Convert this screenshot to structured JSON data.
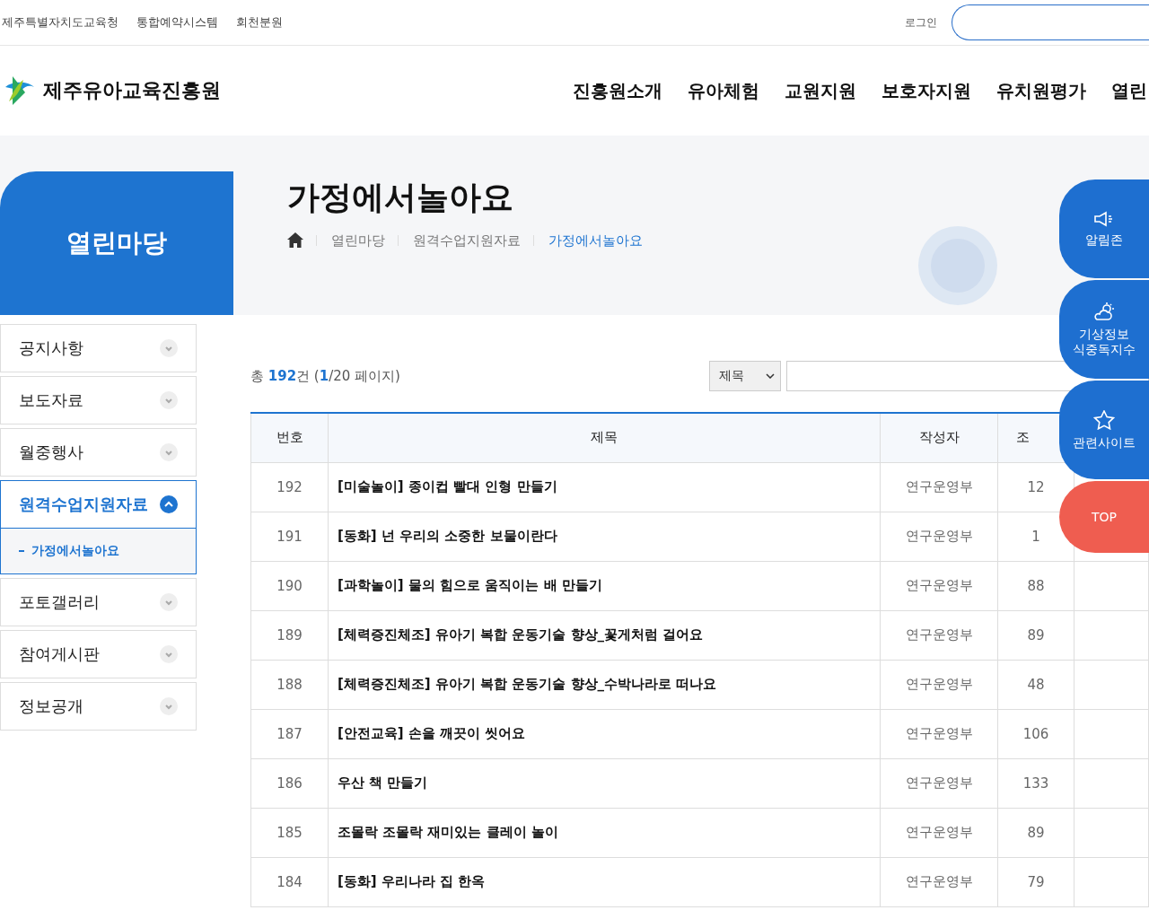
{
  "top_links": [
    "제주특별자치도교육청",
    "통합예약시스템",
    "회천분원"
  ],
  "login": "로그인",
  "logo": "제주유아교육진흥원",
  "nav": [
    "진흥원소개",
    "유아체험",
    "교원지원",
    "보호자지원",
    "유치원평가",
    "열린"
  ],
  "section_title": "열린마당",
  "page_title": "가정에서놀아요",
  "breadcrumb": [
    {
      "label": "열린마당",
      "selected": false
    },
    {
      "label": "원격수업지원자료",
      "selected": false
    },
    {
      "label": "가정에서놀아요",
      "selected": true
    }
  ],
  "sidebar": {
    "items": [
      {
        "label": "공지사항",
        "expanded": false
      },
      {
        "label": "보도자료",
        "expanded": false
      },
      {
        "label": "월중행사",
        "expanded": false
      },
      {
        "label": "원격수업지원자료",
        "expanded": true,
        "children": [
          {
            "label": "가정에서놀아요",
            "selected": true
          }
        ]
      },
      {
        "label": "포토갤러리",
        "expanded": false
      },
      {
        "label": "참여게시판",
        "expanded": false
      },
      {
        "label": "정보공개",
        "expanded": false
      }
    ]
  },
  "summary": "총 **192**건 (**1**/20 페이지)",
  "search": {
    "field": "제목"
  },
  "table": {
    "columns": [
      "번호",
      "제목",
      "작성자",
      "조"
    ],
    "rows": [
      [
        "192",
        "[미술놀이] 종이컵 빨대 인형 만들기",
        "연구운영부",
        "12"
      ],
      [
        "191",
        "[동화] 넌 우리의 소중한 보물이란다",
        "연구운영부",
        "1"
      ],
      [
        "190",
        "[과학놀이] 물의 힘으로 움직이는 배 만들기",
        "연구운영부",
        "88"
      ],
      [
        "189",
        "[체력증진체조] 유아기 복합 운동기술 향상_꽃게처럼 걸어요",
        "연구운영부",
        "89"
      ],
      [
        "188",
        "[체력증진체조] 유아기 복합 운동기술 향상_수박나라로 떠나요",
        "연구운영부",
        "48"
      ],
      [
        "187",
        "[안전교육] 손을 깨끗이 씻어요",
        "연구운영부",
        "106"
      ],
      [
        "186",
        "우산 책 만들기",
        "연구운영부",
        "133"
      ],
      [
        "185",
        "조몰락 조몰락 재미있는 클레이 놀이",
        "연구운영부",
        "89"
      ],
      [
        "184",
        "[동화] 우리나라 집 한옥",
        "연구운영부",
        "79"
      ]
    ]
  },
  "quick_menu": [
    {
      "kind": "speaker",
      "label": "알림존"
    },
    {
      "kind": "weather",
      "label": "기상정보\n식중독지수"
    },
    {
      "kind": "star",
      "label": "관련사이트"
    },
    {
      "kind": "top",
      "label": "TOP"
    }
  ]
}
